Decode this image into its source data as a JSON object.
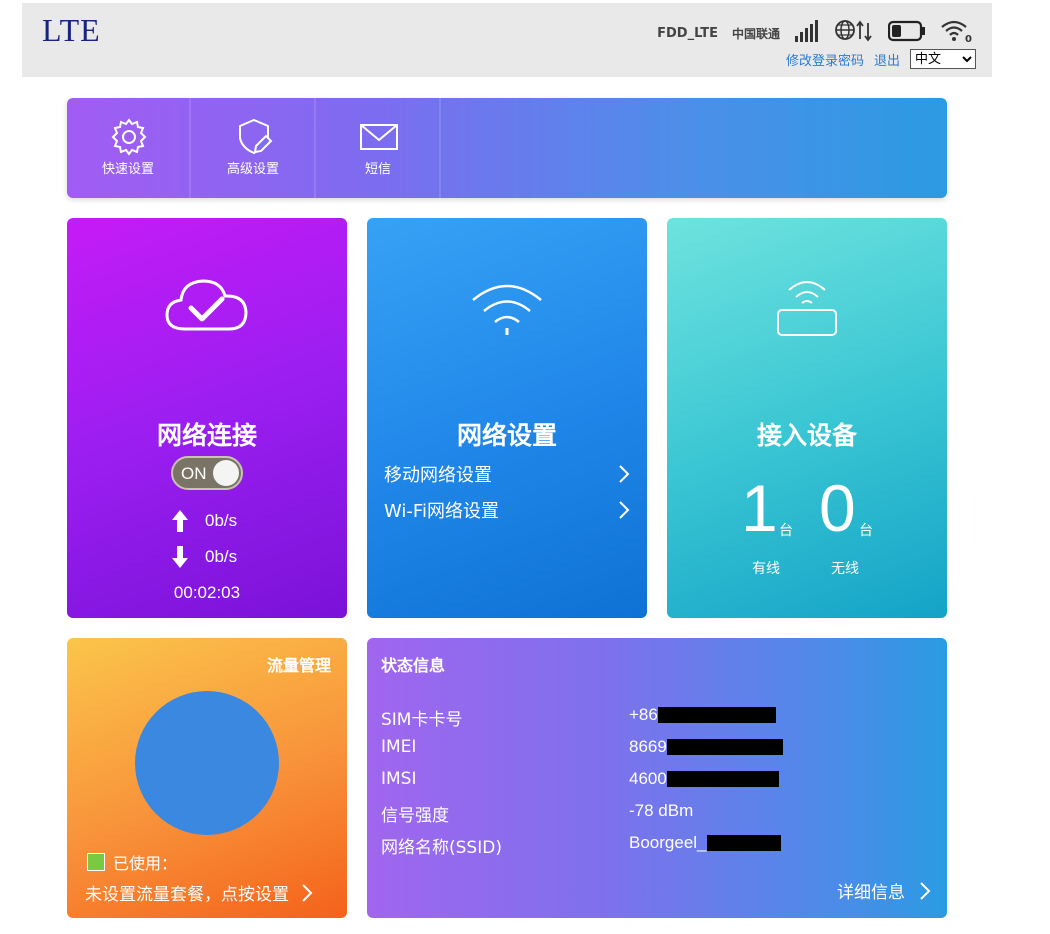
{
  "header": {
    "logo": "LTE",
    "network_type": "FDD_LTE",
    "carrier": "中国联通",
    "signal_bars": 5,
    "battery_level": 0.35,
    "wifi_clients": "0",
    "change_password_link": "修改登录密码",
    "logout_link": "退出",
    "language_selected": "中文"
  },
  "nav": {
    "items": [
      {
        "label": "快速设置",
        "icon": "gear-icon"
      },
      {
        "label": "高级设置",
        "icon": "shield-edit-icon"
      },
      {
        "label": "短信",
        "icon": "envelope-icon"
      }
    ]
  },
  "network_card": {
    "title": "网络连接",
    "toggle_label": "ON",
    "toggle_on": true,
    "upload_rate": "0b/s",
    "download_rate": "0b/s",
    "duration": "00:02:03",
    "colors": {
      "start": "#c51bf7",
      "end": "#7a12d8"
    }
  },
  "settings_card": {
    "title": "网络设置",
    "links": [
      {
        "label": "移动网络设置"
      },
      {
        "label": "Wi-Fi网络设置"
      }
    ]
  },
  "devices_card": {
    "title": "接入设备",
    "wired_count": "1",
    "wireless_count": "0",
    "unit": "台",
    "wired_label": "有线",
    "wireless_label": "无线"
  },
  "flow_card": {
    "title": "流量管理",
    "used_label": "已使用：",
    "setup_link": "未设置流量套餐，点按设置",
    "colors": {
      "used": "#7ac943",
      "circle": "#3a88e0"
    }
  },
  "status_card": {
    "title": "状态信息",
    "rows": [
      {
        "label": "SIM卡卡号",
        "value": "+86"
      },
      {
        "label": "IMEI",
        "value": "8669"
      },
      {
        "label": "IMSI",
        "value": "4600"
      },
      {
        "label": "信号强度",
        "value": "-78 dBm"
      },
      {
        "label": "网络名称(SSID)",
        "value": "Boorgeel_"
      }
    ],
    "detail_link": "详细信息"
  }
}
